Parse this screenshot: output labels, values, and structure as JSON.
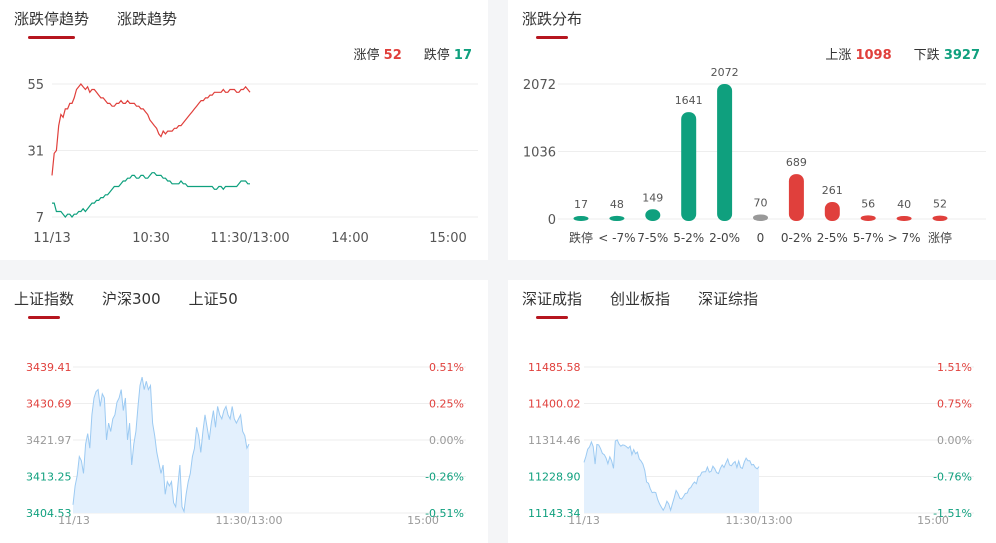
{
  "panel_limit": {
    "tabs": [
      "涨跌停趋势",
      "涨跌趋势"
    ],
    "stat_up_label": "涨停",
    "stat_up_value": "52",
    "stat_down_label": "跌停",
    "stat_down_value": "17"
  },
  "panel_dist": {
    "tabs": [
      "涨跌分布"
    ],
    "stat_up_label": "上涨",
    "stat_up_value": "1098",
    "stat_down_label": "下跌",
    "stat_down_value": "3927"
  },
  "panel_sh": {
    "tabs": [
      "上证指数",
      "沪深300",
      "上证50"
    ]
  },
  "panel_sz": {
    "tabs": [
      "深证成指",
      "创业板指",
      "深证综指"
    ]
  },
  "colors": {
    "up": "#e0403c",
    "down": "#0fa07e",
    "flat": "#999999",
    "area_stroke": "#9ccaf2",
    "area_fill": "#e3f0fd",
    "grid": "#eeeeee"
  },
  "chart_data": [
    {
      "type": "line",
      "title": "",
      "x_ticks": [
        "11/13",
        "10:30",
        "11:30/13:00",
        "14:00",
        "15:00"
      ],
      "y_ticks": [
        55,
        31,
        7
      ],
      "ylim": [
        7,
        55
      ],
      "series": [
        {
          "name": "涨停",
          "color": "#e0403c",
          "values": [
            22,
            30,
            31,
            40,
            44,
            43,
            46,
            46,
            48,
            48,
            50,
            53,
            54,
            55,
            54,
            53,
            54,
            52,
            53,
            53,
            52,
            51,
            50,
            50,
            49,
            48,
            48,
            47,
            47,
            48,
            48,
            49,
            48,
            48,
            49,
            48,
            48,
            48,
            47,
            47,
            46,
            46,
            45,
            44,
            42,
            41,
            40,
            39,
            37,
            36,
            38,
            37,
            38,
            38,
            38,
            39,
            39,
            40,
            40,
            41,
            42,
            43,
            44,
            45,
            46,
            47,
            48,
            49,
            49,
            50,
            50,
            51,
            51,
            52,
            52,
            52,
            52,
            53,
            52,
            52,
            53,
            53,
            53,
            52,
            52,
            53,
            53,
            54,
            53,
            52
          ]
        },
        {
          "name": "跌停",
          "color": "#0fa07e",
          "values": [
            12,
            12,
            9,
            9,
            9,
            8,
            7,
            8,
            8,
            7,
            8,
            8,
            9,
            9,
            10,
            9,
            10,
            11,
            12,
            12,
            13,
            13,
            14,
            14,
            15,
            15,
            16,
            17,
            18,
            18,
            18,
            19,
            20,
            20,
            21,
            21,
            22,
            22,
            21,
            21,
            22,
            22,
            21,
            21,
            22,
            23,
            23,
            22,
            22,
            22,
            21,
            21,
            20,
            20,
            19,
            19,
            19,
            19,
            20,
            19,
            19,
            18,
            18,
            18,
            18,
            18,
            18,
            18,
            18,
            18,
            18,
            18,
            18,
            17,
            17,
            18,
            18,
            17,
            18,
            18,
            18,
            18,
            18,
            18,
            19,
            20,
            20,
            20,
            19,
            19
          ]
        }
      ]
    },
    {
      "type": "bar",
      "title": "",
      "categories": [
        "跌停",
        "< -7%",
        "7-5%",
        "5-2%",
        "2-0%",
        "0",
        "0-2%",
        "2-5%",
        "5-7%",
        "> 7%",
        "涨停"
      ],
      "values": [
        17,
        48,
        149,
        1641,
        2072,
        70,
        689,
        261,
        56,
        40,
        52
      ],
      "bar_colors": [
        "#0fa07e",
        "#0fa07e",
        "#0fa07e",
        "#0fa07e",
        "#0fa07e",
        "#999999",
        "#e0403c",
        "#e0403c",
        "#e0403c",
        "#e0403c",
        "#e0403c"
      ],
      "y_ticks": [
        2072,
        1036,
        0
      ],
      "ylim": [
        0,
        2072
      ]
    },
    {
      "type": "area",
      "title": "",
      "x_ticks": [
        "11/13",
        "11:30/13:00",
        "15:00"
      ],
      "y_ticks_left": [
        "3439.41",
        "3430.69",
        "3421.97",
        "3413.25",
        "3404.53"
      ],
      "y_ticks_right": [
        "0.51%",
        "0.25%",
        "0.00%",
        "-0.26%",
        "-0.51%"
      ],
      "ylim": [
        3404.53,
        3439.41
      ],
      "values": [
        3406.5,
        3411.0,
        3413.5,
        3418.0,
        3417.0,
        3414.0,
        3421.0,
        3423.5,
        3420.0,
        3428.0,
        3432.0,
        3433.5,
        3434.0,
        3430.0,
        3433.0,
        3432.0,
        3422.0,
        3426.0,
        3424.0,
        3427.0,
        3428.0,
        3431.0,
        3432.0,
        3434.0,
        3429.0,
        3432.0,
        3422.0,
        3426.0,
        3416.0,
        3421.0,
        3424.0,
        3430.0,
        3435.0,
        3437.0,
        3434.0,
        3436.0,
        3434.0,
        3435.0,
        3426.0,
        3423.0,
        3419.0,
        3416.5,
        3414.0,
        3416.0,
        3409.0,
        3412.0,
        3411.0,
        3412.0,
        3407.0,
        3406.0,
        3411.0,
        3416.0,
        3406.0,
        3404.9,
        3409.0,
        3412.0,
        3414.0,
        3418.0,
        3420.0,
        3425.0,
        3423.0,
        3419.0,
        3424.0,
        3428.0,
        3425.0,
        3422.0,
        3426.0,
        3429.0,
        3425.0,
        3430.0,
        3428.0,
        3427.0,
        3429.0,
        3430.0,
        3428.0,
        3427.0,
        3430.0,
        3427.0,
        3426.0,
        3427.0,
        3428.0,
        3424.0,
        3423.0,
        3420.0,
        3421.0
      ]
    },
    {
      "type": "area",
      "title": "",
      "x_ticks": [
        "11/13",
        "11:30/13:00",
        "15:00"
      ],
      "y_ticks_left": [
        "11485.58",
        "11400.02",
        "11314.46",
        "11228.90",
        "11143.34"
      ],
      "y_ticks_right": [
        "1.51%",
        "0.75%",
        "0.00%",
        "-0.76%",
        "-1.51%"
      ],
      "ylim": [
        11143.34,
        11485.58
      ],
      "values": [
        11262,
        11275,
        11293,
        11298,
        11310,
        11299,
        11258,
        11304,
        11303,
        11294,
        11283,
        11280,
        11272,
        11259,
        11275,
        11266,
        11248,
        11312,
        11315,
        11305,
        11300,
        11303,
        11302,
        11299,
        11295,
        11300,
        11280,
        11292,
        11282,
        11286,
        11270,
        11265,
        11258,
        11243,
        11216,
        11213,
        11200,
        11191,
        11192,
        11191,
        11175,
        11165,
        11157,
        11150,
        11158,
        11171,
        11165,
        11150,
        11165,
        11180,
        11196,
        11189,
        11178,
        11176,
        11182,
        11189,
        11190,
        11200,
        11203,
        11211,
        11216,
        11212,
        11229,
        11230,
        11239,
        11240,
        11240,
        11251,
        11239,
        11241,
        11253,
        11247,
        11238,
        11236,
        11248,
        11256,
        11250,
        11260,
        11270,
        11256,
        11254,
        11260,
        11264,
        11250,
        11265,
        11250,
        11248,
        11263,
        11272,
        11266,
        11266,
        11256,
        11257,
        11250,
        11247,
        11252
      ]
    }
  ]
}
